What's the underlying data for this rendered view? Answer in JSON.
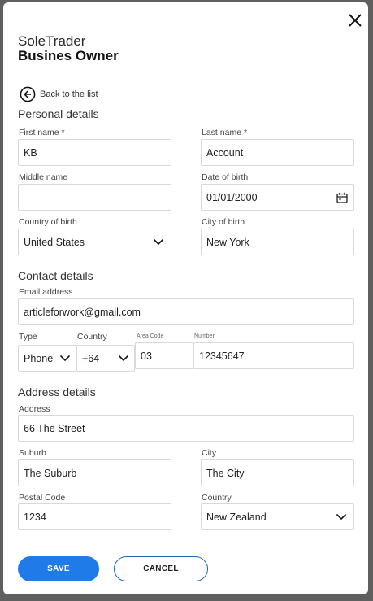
{
  "header": {
    "subtitle": "SoleTrader",
    "title": "Busines Owner"
  },
  "back_label": "Back to the list",
  "personal": {
    "heading": "Personal details",
    "first_name": {
      "label": "First name *",
      "value": "KB"
    },
    "last_name": {
      "label": "Last name *",
      "value": "Account"
    },
    "middle_name": {
      "label": "Middle name",
      "value": ""
    },
    "dob": {
      "label": "Date of birth",
      "value": "01/01/2000"
    },
    "country_of_birth": {
      "label": "Country of birth",
      "value": "United States"
    },
    "city_of_birth": {
      "label": "City of birth",
      "value": "New York"
    }
  },
  "contact": {
    "heading": "Contact details",
    "email": {
      "label": "Email address",
      "value": "articleforwork@gmail.com"
    },
    "type": {
      "label": "Type",
      "value": "Phone"
    },
    "country": {
      "label": "Country",
      "value": "+64"
    },
    "area_code": {
      "label": "Area Code",
      "value": "03"
    },
    "number": {
      "label": "Number",
      "value": "12345647"
    }
  },
  "address": {
    "heading": "Address details",
    "address": {
      "label": "Address",
      "value": "66 The Street"
    },
    "suburb": {
      "label": "Suburb",
      "value": "The Suburb"
    },
    "city": {
      "label": "City",
      "value": "The City"
    },
    "postal_code": {
      "label": "Postal Code",
      "value": "1234"
    },
    "country": {
      "label": "Country",
      "value": "New Zealand"
    }
  },
  "buttons": {
    "save": "SAVE",
    "cancel": "CANCEL"
  },
  "colors": {
    "primary": "#1f7be8",
    "border": "#d9d9d9",
    "cancel_border": "#2266b8"
  }
}
